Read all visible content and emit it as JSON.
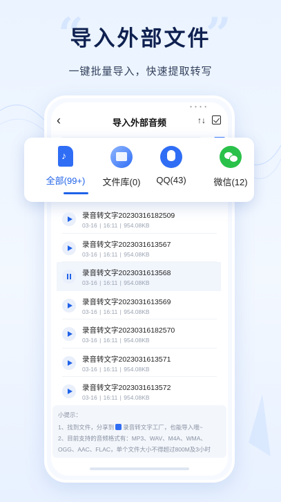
{
  "hero": {
    "title": "导入外部文件",
    "quote_left": "“",
    "quote_right": "”",
    "subtitle": "一键批量导入，快速提取转写"
  },
  "nav": {
    "status_dots": "• • • •",
    "back": "‹",
    "title": "导入外部音频",
    "sort": "↑↓"
  },
  "tabs": [
    {
      "label": "全部(99+)",
      "icon": "music-document-icon",
      "active": true
    },
    {
      "label": "文件库(0)",
      "icon": "file-library-icon",
      "active": false
    },
    {
      "label": "QQ(43)",
      "icon": "qq-icon",
      "active": false
    },
    {
      "label": "微信(12)",
      "icon": "wechat-icon",
      "active": false
    }
  ],
  "files": [
    {
      "name": "录音转文字20230316182509",
      "meta": "03-16 | 16:11 | 954.08KB",
      "state": "play"
    },
    {
      "name": "录音转文字2023031613567",
      "meta": "03-16 | 16:11 | 954.08KB",
      "state": "play"
    },
    {
      "name": "录音转文字2023031613568",
      "meta": "03-16 | 16:11 | 954.08KB",
      "state": "pause"
    },
    {
      "name": "录音转文字2023031613569",
      "meta": "03-16 | 16:11 | 954.08KB",
      "state": "play"
    },
    {
      "name": "录音转文字20230316182570",
      "meta": "03-16 | 16:11 | 954.08KB",
      "state": "play"
    },
    {
      "name": "录音转文字2023031613571",
      "meta": "03-16 | 16:11 | 954.08KB",
      "state": "play"
    },
    {
      "name": "录音转文字2023031613572",
      "meta": "03-16 | 16:11 | 954.08KB",
      "state": "play"
    }
  ],
  "tips": {
    "title": "小提示：",
    "line1_a": "1、找到文件，分享到",
    "line1_b": "录音转文字工厂，也能导入哦~",
    "line2": "2、目前支持的音频格式有：MP3、WAV、M4A、WMA、",
    "line3": "OGG、AAC、FLAC，单个文件大小不得超过800M及3小时"
  },
  "colors": {
    "accent": "#1f62e8",
    "headline": "#0f2150",
    "wechat": "#2ac14a"
  }
}
